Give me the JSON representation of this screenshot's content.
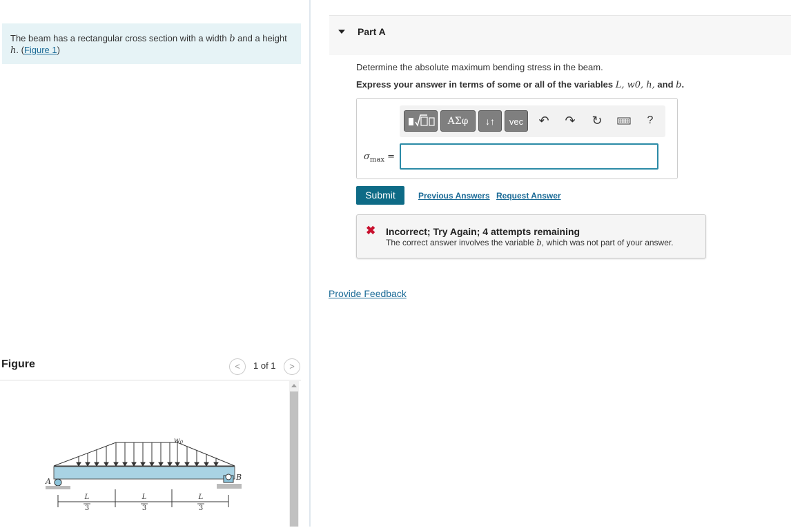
{
  "intro": {
    "text_before": "The beam has a rectangular cross section with a width ",
    "var_b": "b",
    "text_mid": " and a height",
    "var_h": "h",
    "text_after": ". (",
    "figure_link": "Figure 1",
    "text_close": ")"
  },
  "figure_panel": {
    "title": "Figure",
    "prev_symbol": "<",
    "next_symbol": ">",
    "pager": "1 of 1",
    "labels": {
      "point_a": "A",
      "point_b": "B",
      "load": "w0",
      "span_num": "L",
      "span_den": "3"
    }
  },
  "part": {
    "toggle_icon": "triangle-down-icon",
    "title": "Part A",
    "question": "Determine the absolute maximum bending stress in the beam.",
    "instruction_prefix": "Express your answer in terms of some or all of the variables ",
    "instruction_vars": "L, w0, h,",
    "instruction_and": " and ",
    "instruction_last_var": "b",
    "instruction_end": ".",
    "answer_label_main": "σ",
    "answer_label_sub": "max",
    "answer_label_eq": " =",
    "answer_value": ""
  },
  "toolbar": {
    "templates_icon": "templates-icon",
    "greek_label": "ΑΣφ",
    "arrows_label": "↓↑",
    "vec_label": "vec",
    "undo_icon": "undo-icon",
    "redo_icon": "redo-icon",
    "reset_icon": "reset-icon",
    "keyboard_icon": "keyboard-icon",
    "help_label": "?"
  },
  "actions": {
    "submit": "Submit",
    "previous_answers": "Previous Answers",
    "request_answer": "Request Answer"
  },
  "feedback": {
    "status_icon": "x-icon",
    "title": "Incorrect; Try Again; 4 attempts remaining",
    "message_before": "The correct answer involves the variable ",
    "message_var": "b",
    "message_after": ", which was not part of your answer.",
    "color": "#c8102e"
  },
  "provide_feedback": "Provide Feedback",
  "colors": {
    "intro_bg": "#e6f3f6",
    "submit_bg": "#0e6b86",
    "link": "#1a6a96",
    "input_border": "#2a8aa6"
  }
}
